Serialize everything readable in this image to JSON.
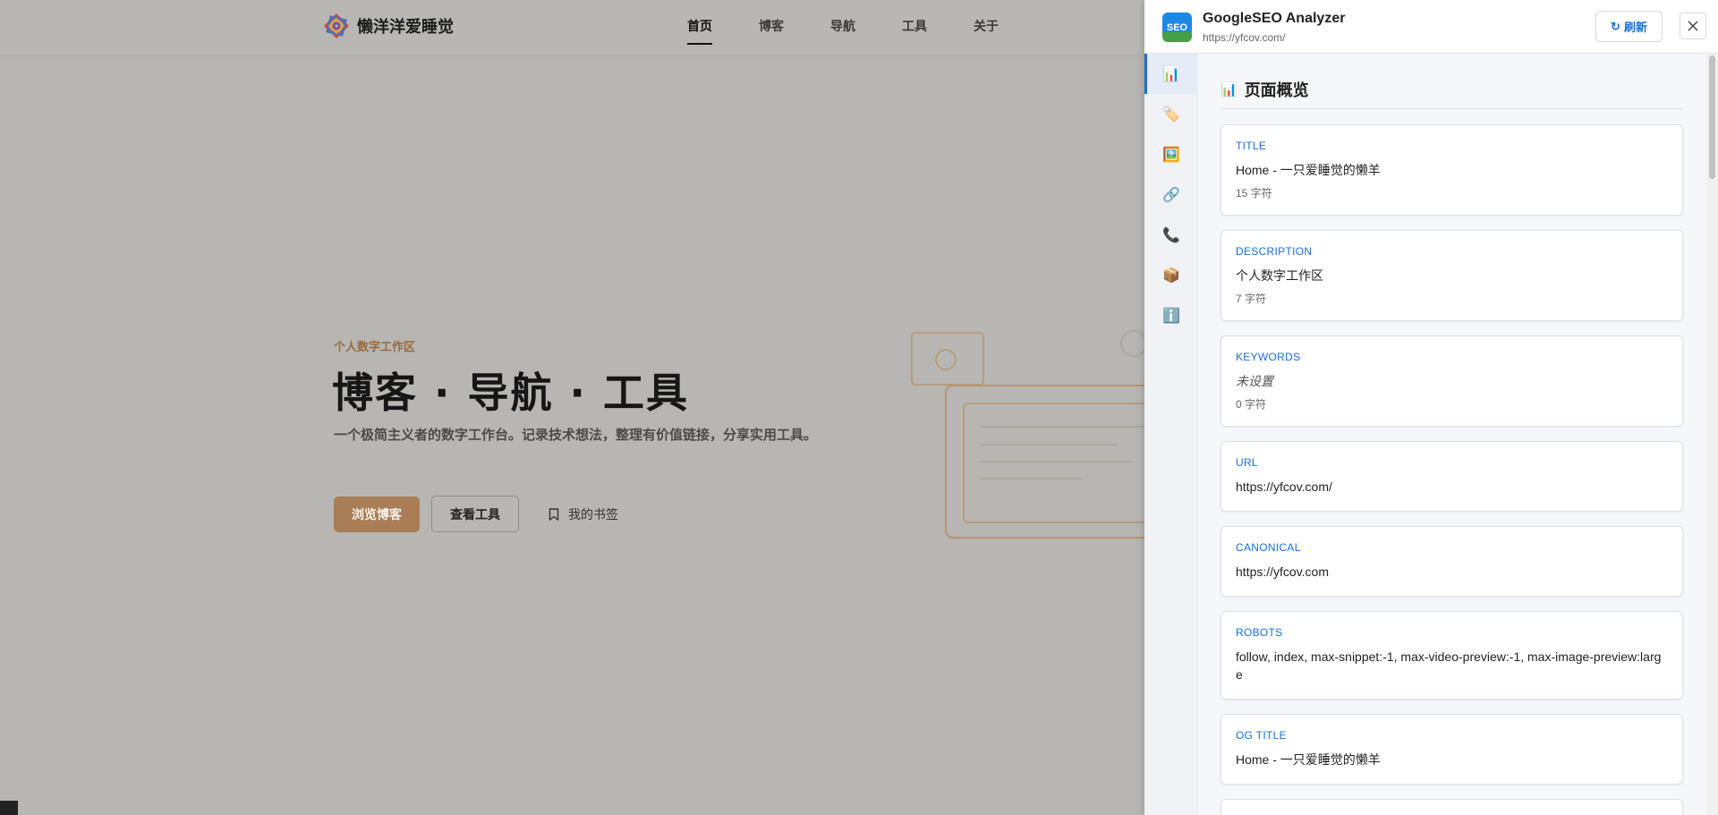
{
  "site": {
    "brand": "懒洋洋爱睡觉",
    "nav": [
      "首页",
      "博客",
      "导航",
      "工具",
      "关于"
    ],
    "active_nav": "首页",
    "hero": {
      "eyebrow": "个人数字工作区",
      "title": "博客 · 导航 · 工具",
      "description": "一个极简主义者的数字工作台。记录技术想法，整理有价值链接，分享实用工具。",
      "primary_button": "浏览博客",
      "secondary_button": "查看工具",
      "bookmark_link": "我的书签"
    }
  },
  "panel": {
    "logo_text": "SEO",
    "title": "GoogleSEO Analyzer",
    "url": "https://yfcov.com/",
    "refresh_label": "刷新",
    "refresh_icon": "↻",
    "close_icon": "✕",
    "sidebar": [
      {
        "icon": "📊",
        "name": "overview",
        "active": true
      },
      {
        "icon": "🏷️",
        "name": "tags",
        "active": false
      },
      {
        "icon": "🖼️",
        "name": "images",
        "active": false
      },
      {
        "icon": "🔗",
        "name": "links",
        "active": false
      },
      {
        "icon": "📞",
        "name": "contact",
        "active": false
      },
      {
        "icon": "📦",
        "name": "resources",
        "active": false
      },
      {
        "icon": "ℹ️",
        "name": "info",
        "active": false
      }
    ],
    "section_icon": "📊",
    "section_title": "页面概览",
    "cards": [
      {
        "label": "TITLE",
        "value": "Home - 一只爱睡觉的懒羊",
        "meta": "15 字符"
      },
      {
        "label": "DESCRIPTION",
        "value": "个人数字工作区",
        "meta": "7 字符"
      },
      {
        "label": "KEYWORDS",
        "value": "未设置",
        "meta": "0 字符",
        "unset": true
      },
      {
        "label": "URL",
        "value": "https://yfcov.com/"
      },
      {
        "label": "CANONICAL",
        "value": "https://yfcov.com"
      },
      {
        "label": "ROBOTS",
        "value": "follow, index, max-snippet:-1, max-video-preview:-1, max-image-preview:large"
      },
      {
        "label": "OG TITLE",
        "value": "Home - 一只爱睡觉的懒羊"
      }
    ]
  }
}
